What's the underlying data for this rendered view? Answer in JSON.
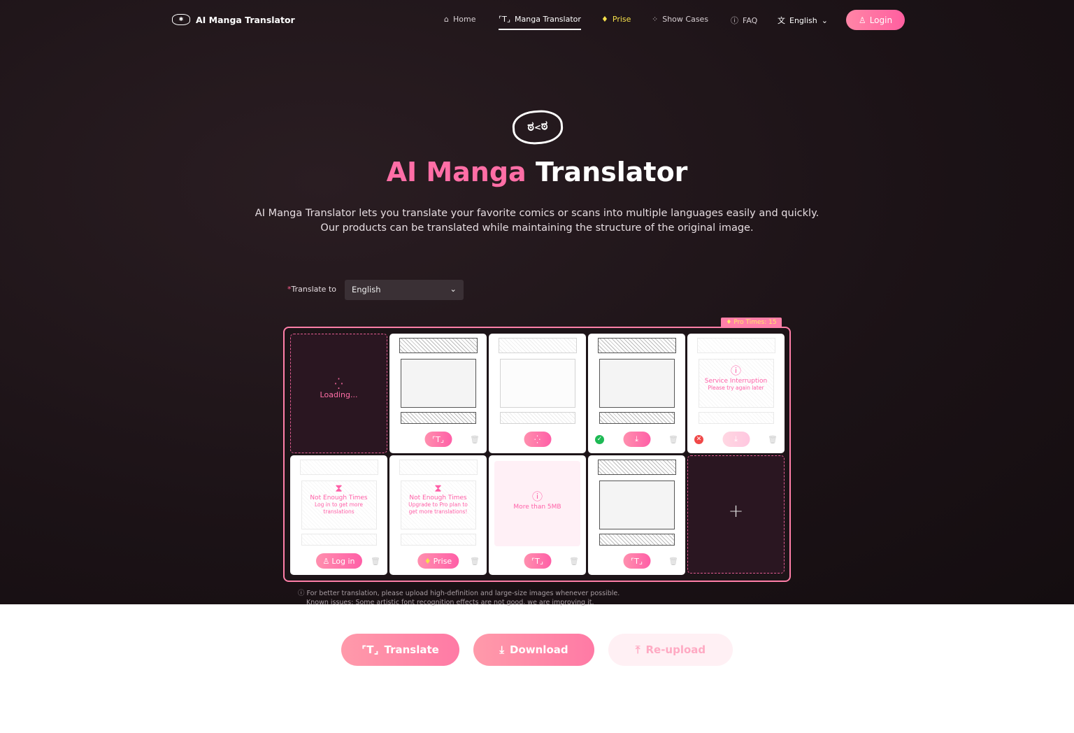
{
  "nav": {
    "brand": "AI Manga Translator",
    "items": [
      {
        "label": "Home",
        "icon": "home-icon"
      },
      {
        "label": "Manga Translator",
        "icon": "translate-scan-icon",
        "active": true
      },
      {
        "label": "Prise",
        "icon": "diamond-icon"
      },
      {
        "label": "Show Cases",
        "icon": "sparkle-icon"
      },
      {
        "label": "FAQ",
        "icon": "question-icon"
      }
    ],
    "language": "English",
    "login": "Login"
  },
  "hero": {
    "title_pink": "AI Manga",
    "title_white": "Translator",
    "subtitle_1": "AI Manga Translator lets you translate your favorite comics or scans into multiple languages easily and quickly.",
    "subtitle_2": "Our products can be translated while maintaining the structure of the original image."
  },
  "form": {
    "required_mark": "*",
    "label": "Translate to",
    "language": "English"
  },
  "pro_times": "Pro Times: 15",
  "cards": {
    "loading": "Loading...",
    "service_title": "Service Interruption",
    "service_sub": "Please try again later",
    "net_title": "Not Enough Times",
    "net_login_sub": "Log in to get more translations",
    "net_pro_sub": "Upgrade to Pro plan to get more translations!",
    "login_btn": "Log in",
    "prise_btn": "Prise",
    "size_msg": "More than 5MB",
    "add": "+"
  },
  "notes": {
    "line1": "For better translation, please upload high-definition and large-size images whenever possible.",
    "line2": "Known issues: Some artistic font recognition effects are not good, we are improving it."
  },
  "actions": {
    "translate": "Translate",
    "download": "Download",
    "reupload": "Re-upload"
  },
  "colors": {
    "accent": "#ff6ea6",
    "background": "#1b1216",
    "success": "#1db954",
    "error": "#f04848",
    "prise": "#f5e04a"
  }
}
